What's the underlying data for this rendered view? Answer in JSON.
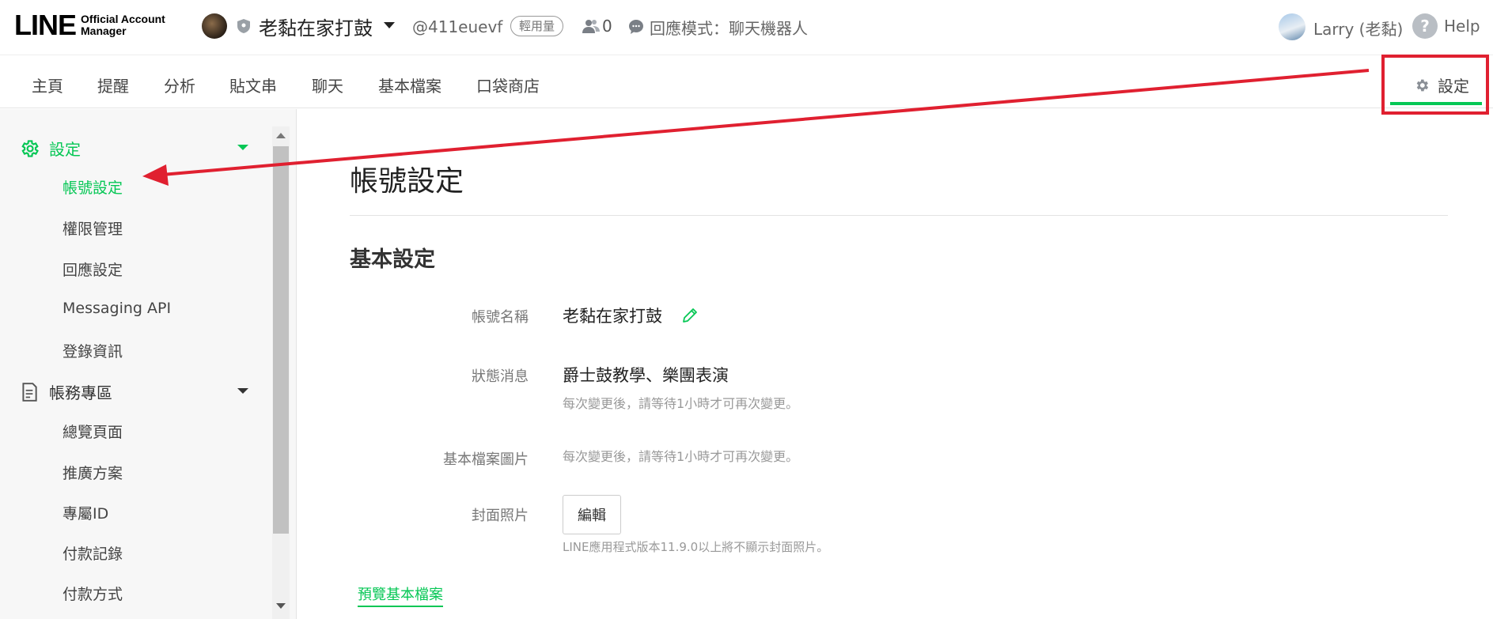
{
  "header": {
    "logo_main": "LINE",
    "logo_sub_line1": "Official Account",
    "logo_sub_line2": "Manager",
    "account_name": "老黏在家打鼓",
    "account_id": "@411euevf",
    "plan_badge": "輕用量",
    "friends_count": "0",
    "response_mode": "回應模式：聊天機器人",
    "user_name": "Larry (老黏)",
    "help_glyph": "?",
    "help_label": "Help"
  },
  "tabs": {
    "home": "主頁",
    "reminders": "提醒",
    "analytics": "分析",
    "posts": "貼文串",
    "chat": "聊天",
    "profile": "基本檔案",
    "shop": "口袋商店",
    "settings": "設定"
  },
  "sidebar": {
    "settings_header": "設定",
    "settings_items": [
      "帳號設定",
      "權限管理",
      "回應設定",
      "Messaging API",
      "登錄資訊"
    ],
    "billing_header": "帳務專區",
    "billing_items": [
      "總覽頁面",
      "推廣方案",
      "專屬ID",
      "付款記錄",
      "付款方式"
    ]
  },
  "main": {
    "page_title": "帳號設定",
    "section_title": "基本設定",
    "account_name_label": "帳號名稱",
    "account_name_value": "老黏在家打鼓",
    "status_label": "狀態消息",
    "status_value": "爵士鼓教學、樂團表演",
    "status_hint": "每次變更後，請等待1小時才可再次變更。",
    "profile_image_label": "基本檔案圖片",
    "profile_image_hint": "每次變更後，請等待1小時才可再次變更。",
    "cover_label": "封面照片",
    "cover_edit_button": "編輯",
    "cover_hint": "LINE應用程式版本11.9.0以上將不顯示封面照片。",
    "preview_link": "預覽基本檔案"
  },
  "colors": {
    "accent_green": "#06c755",
    "annotation_red": "#e02030"
  }
}
